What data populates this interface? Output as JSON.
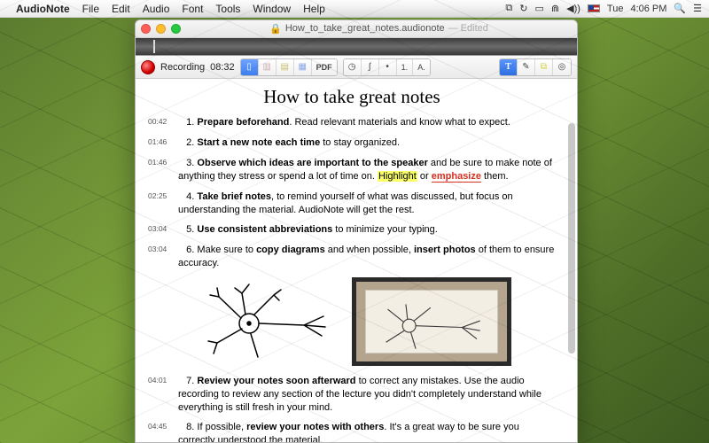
{
  "menubar": {
    "app": "AudioNote",
    "items": [
      "File",
      "Edit",
      "Audio",
      "Font",
      "Tools",
      "Window",
      "Help"
    ],
    "status": {
      "sync_icon": "↻",
      "dropbox": "⬚",
      "battery": "▮▮",
      "wifi": "⋐",
      "volume": "🔊",
      "search": "🔍",
      "menu": "☰",
      "day": "Tue",
      "time": "4:06 PM"
    }
  },
  "window": {
    "filename": "How_to_take_great_notes.audionote",
    "edited_label": "— Edited"
  },
  "toolbar": {
    "rec_label": "Recording",
    "rec_time": "08:32",
    "pdf": "PDF",
    "clock": "◷",
    "integral": "∫",
    "bullet": "•",
    "list_num": "1.",
    "list_alpha": "A.",
    "text_tool": "T",
    "pencil": "✎",
    "highlighter": "⧉",
    "camera": "◎"
  },
  "doc": {
    "title": "How to take great notes",
    "notes": [
      {
        "ts": "00:42",
        "num": "1.",
        "lead": "Prepare beforehand",
        "rest": ". Read relevant materials and know what to expect."
      },
      {
        "ts": "01:46",
        "num": "2.",
        "lead": "Start a new note each time",
        "rest": " to stay organized."
      },
      {
        "ts": "01:46",
        "num": "3.",
        "lead": "Observe which ideas are important to the speaker",
        "rest": " and be sure to make note of anything they stress or spend a lot of time on. ",
        "hl": "Highlight",
        "mid": " or ",
        "emph": "emphasize",
        "end": " them."
      },
      {
        "ts": "02:25",
        "num": "4.",
        "lead": "Take brief notes",
        "rest": ", to remind yourself of what was discussed, but focus on understanding the material. AudioNote will get the rest."
      },
      {
        "ts": "03:04",
        "num": "5.",
        "lead": "Use consistent abbreviations",
        "rest": " to minimize your typing."
      },
      {
        "ts": "03:04",
        "num": "6.",
        "pretext": "Make sure to ",
        "lead": "copy diagrams",
        "mid2": " and when possible, ",
        "lead2": "insert photos",
        "rest": " of them to ensure accuracy."
      },
      {
        "ts": "04:01",
        "num": "7.",
        "lead": "Review your notes soon afterward",
        "rest": " to correct any mistakes. Use the audio recording to review any section of the lecture you didn't completely understand while everything is still fresh in your mind."
      },
      {
        "ts": "04:45",
        "num": "8.",
        "pretext": "If possible, ",
        "lead": "review your notes with others",
        "rest": ". It's a great way to be sure you correctly understood the material."
      }
    ]
  }
}
